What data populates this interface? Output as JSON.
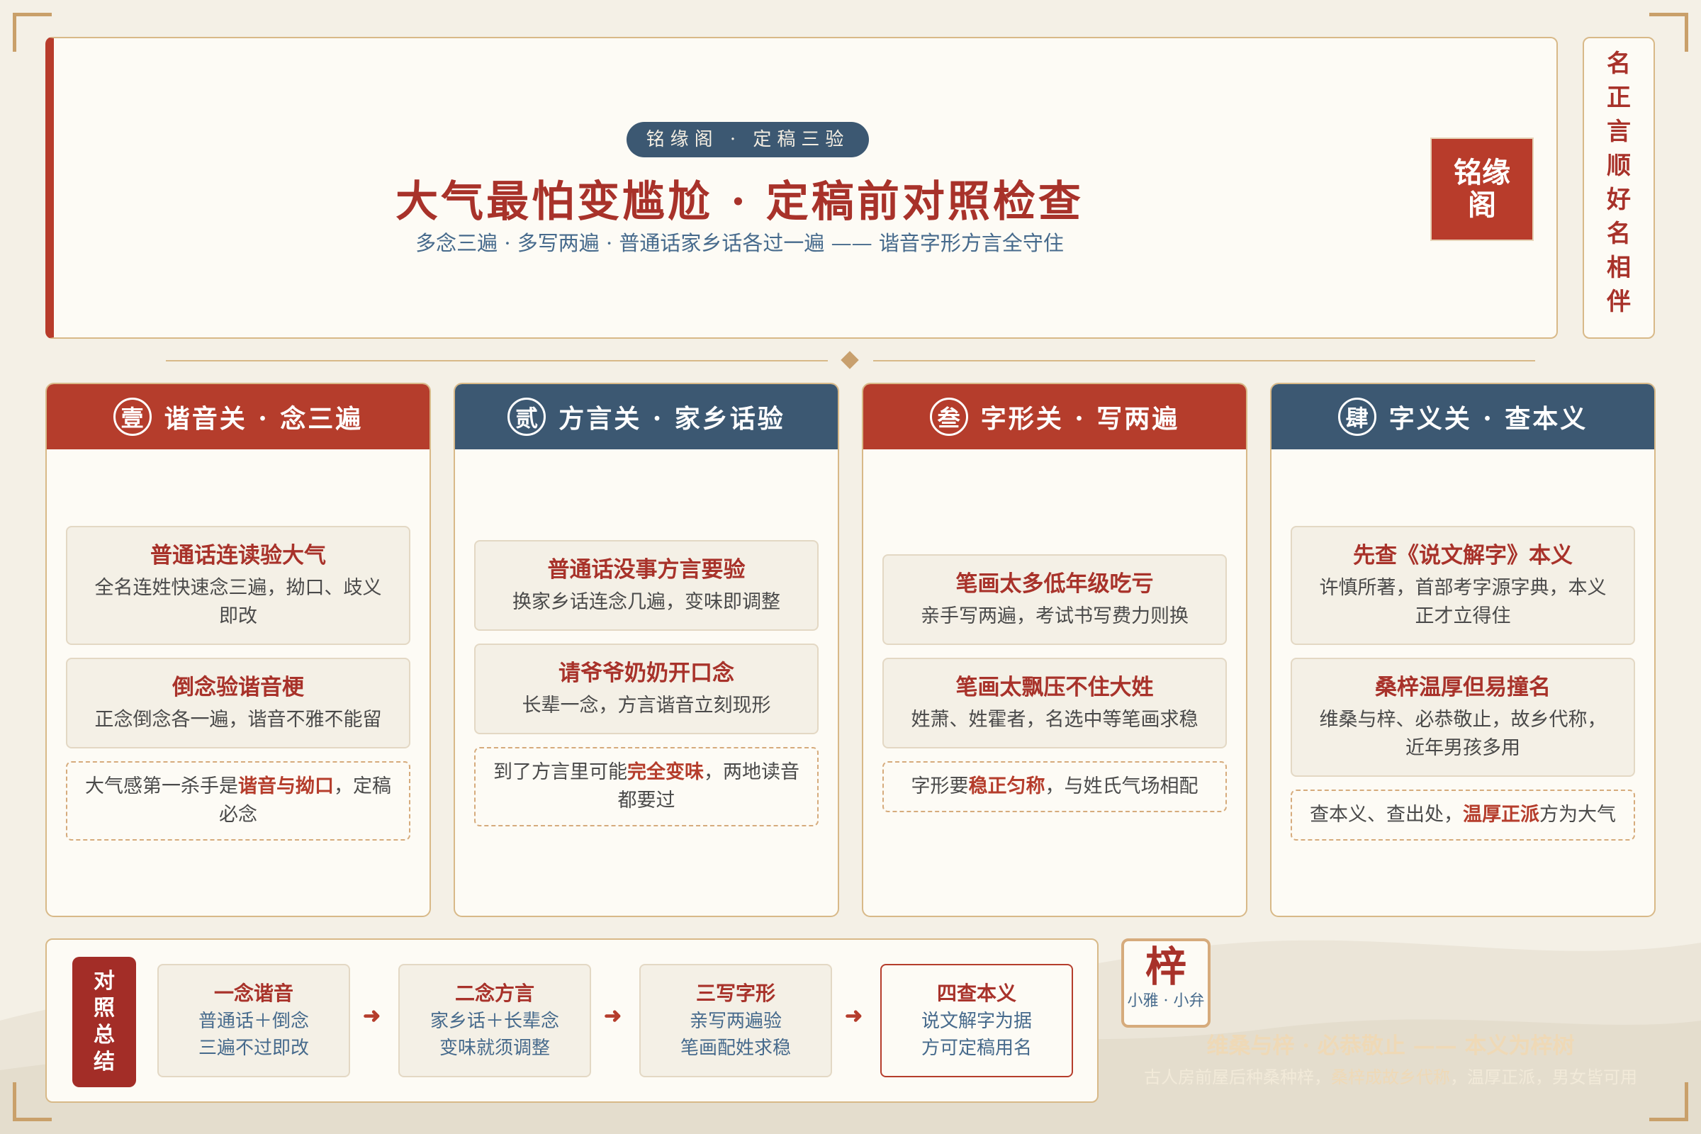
{
  "header": {
    "pill": "铭缘阁 · 定稿三验",
    "title": "大气最怕变尴尬 · 定稿前对照检查",
    "subtitle": "多念三遍 · 多写两遍 · 普通话家乡话各过一遍 —— 谐音字形方言全守住",
    "seal_line1": "铭缘",
    "seal_line2": "阁"
  },
  "side_banner": [
    "名",
    "正",
    "言",
    "顺",
    "好",
    "名",
    "相",
    "伴"
  ],
  "cards": [
    {
      "badge": "壹",
      "title": "谐音关 · 念三遍",
      "items": [
        {
          "title": "普通话连读验大气",
          "desc": "全名连姓快速念三遍，拗口、歧义即改"
        },
        {
          "title": "倒念验谐音梗",
          "desc": "正念倒念各一遍，谐音不雅不能留"
        }
      ],
      "note_pre": "大气感第一杀手是",
      "note_hl": "谐音与拗口",
      "note_post": "，定稿必念"
    },
    {
      "badge": "贰",
      "title": "方言关 · 家乡话验",
      "items": [
        {
          "title": "普通话没事方言要验",
          "desc": "换家乡话连念几遍，变味即调整"
        },
        {
          "title": "请爷爷奶奶开口念",
          "desc": "长辈一念，方言谐音立刻现形"
        }
      ],
      "note_pre": "到了方言里可能",
      "note_hl": "完全变味",
      "note_post": "，两地读音都要过"
    },
    {
      "badge": "叁",
      "title": "字形关 · 写两遍",
      "items": [
        {
          "title": "笔画太多低年级吃亏",
          "desc": "亲手写两遍，考试书写费力则换"
        },
        {
          "title": "笔画太飘压不住大姓",
          "desc": "姓萧、姓霍者，名选中等笔画求稳"
        }
      ],
      "note_pre": "字形要",
      "note_hl": "稳正匀称",
      "note_post": "，与姓氏气场相配"
    },
    {
      "badge": "肆",
      "title": "字义关 · 查本义",
      "items": [
        {
          "title": "先查《说文解字》本义",
          "desc": "许慎所著，首部考字源字典，本义正才立得住"
        },
        {
          "title": "桑梓温厚但易撞名",
          "desc": "维桑与梓、必恭敬止，故乡代称，近年男孩多用"
        }
      ],
      "note_pre": "查本义、查出处，",
      "note_hl": "温厚正派",
      "note_post": "方为大气"
    }
  ],
  "summary": {
    "label": [
      "对",
      "照",
      "总",
      "结"
    ],
    "steps": [
      {
        "title": "一念谐音",
        "line1": "普通话＋倒念",
        "line2": "三遍不过即改"
      },
      {
        "title": "二念方言",
        "line1": "家乡话＋长辈念",
        "line2": "变味就须调整"
      },
      {
        "title": "三写字形",
        "line1": "亲写两遍验",
        "line2": "笔画配姓求稳"
      },
      {
        "title": "四查本义",
        "line1": "说文解字为据",
        "line2": "方可定稿用名"
      }
    ],
    "arrow": "➜"
  },
  "zi_badge": {
    "char": "梓",
    "sub": "小雅 · 小弁"
  },
  "motto": {
    "line1": "维桑与梓 · 必恭敬止 —— 本义为梓树",
    "line2_pre": "古人房前屋后种桑种梓，",
    "line2_hl": "桑梓成故乡代称",
    "line2_post": "，温厚正派，男女皆可用"
  },
  "colors": {
    "red": "#b53d2c",
    "blue": "#3c5872",
    "gold": "#d8b988",
    "paper": "#fdfbf5",
    "background": "#f4f0e6"
  }
}
